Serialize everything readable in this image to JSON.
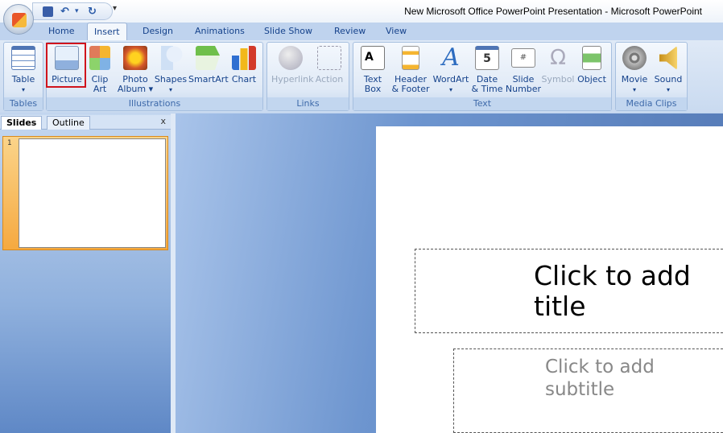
{
  "window": {
    "title": "New Microsoft Office PowerPoint Presentation - Microsoft PowerPoint"
  },
  "qat": {
    "save": "save-icon",
    "undo": "↶",
    "redo": "↻",
    "customize": "▾"
  },
  "tabs": [
    "Home",
    "Insert",
    "Design",
    "Animations",
    "Slide Show",
    "Review",
    "View"
  ],
  "active_tab": "Insert",
  "groups": [
    "Tables",
    "Illustrations",
    "Links",
    "Text",
    "Media Clips"
  ],
  "buttons": {
    "table": "Table",
    "picture": "Picture",
    "clipart1": "Clip",
    "clipart2": "Art",
    "photo1": "Photo",
    "photo2": "Album ▾",
    "shapes": "Shapes",
    "smartart": "SmartArt",
    "chart": "Chart",
    "hyperlink": "Hyperlink",
    "action": "Action",
    "textbox1": "Text",
    "textbox2": "Box",
    "header1": "Header",
    "header2": "& Footer",
    "wordart": "WordArt",
    "date1": "Date",
    "date2": "& Time",
    "slidenum1": "Slide",
    "slidenum2": "Number",
    "symbol": "Symbol",
    "object": "Object",
    "movie": "Movie",
    "sound": "Sound",
    "dropdown": "▾"
  },
  "highlight_color": "#d0141c",
  "left_pane": {
    "tabs": [
      "Slides",
      "Outline"
    ],
    "close": "x",
    "slide_number": "1"
  },
  "slide": {
    "title_placeholder": "Click to add title",
    "subtitle_placeholder": "Click to add subtitle"
  }
}
